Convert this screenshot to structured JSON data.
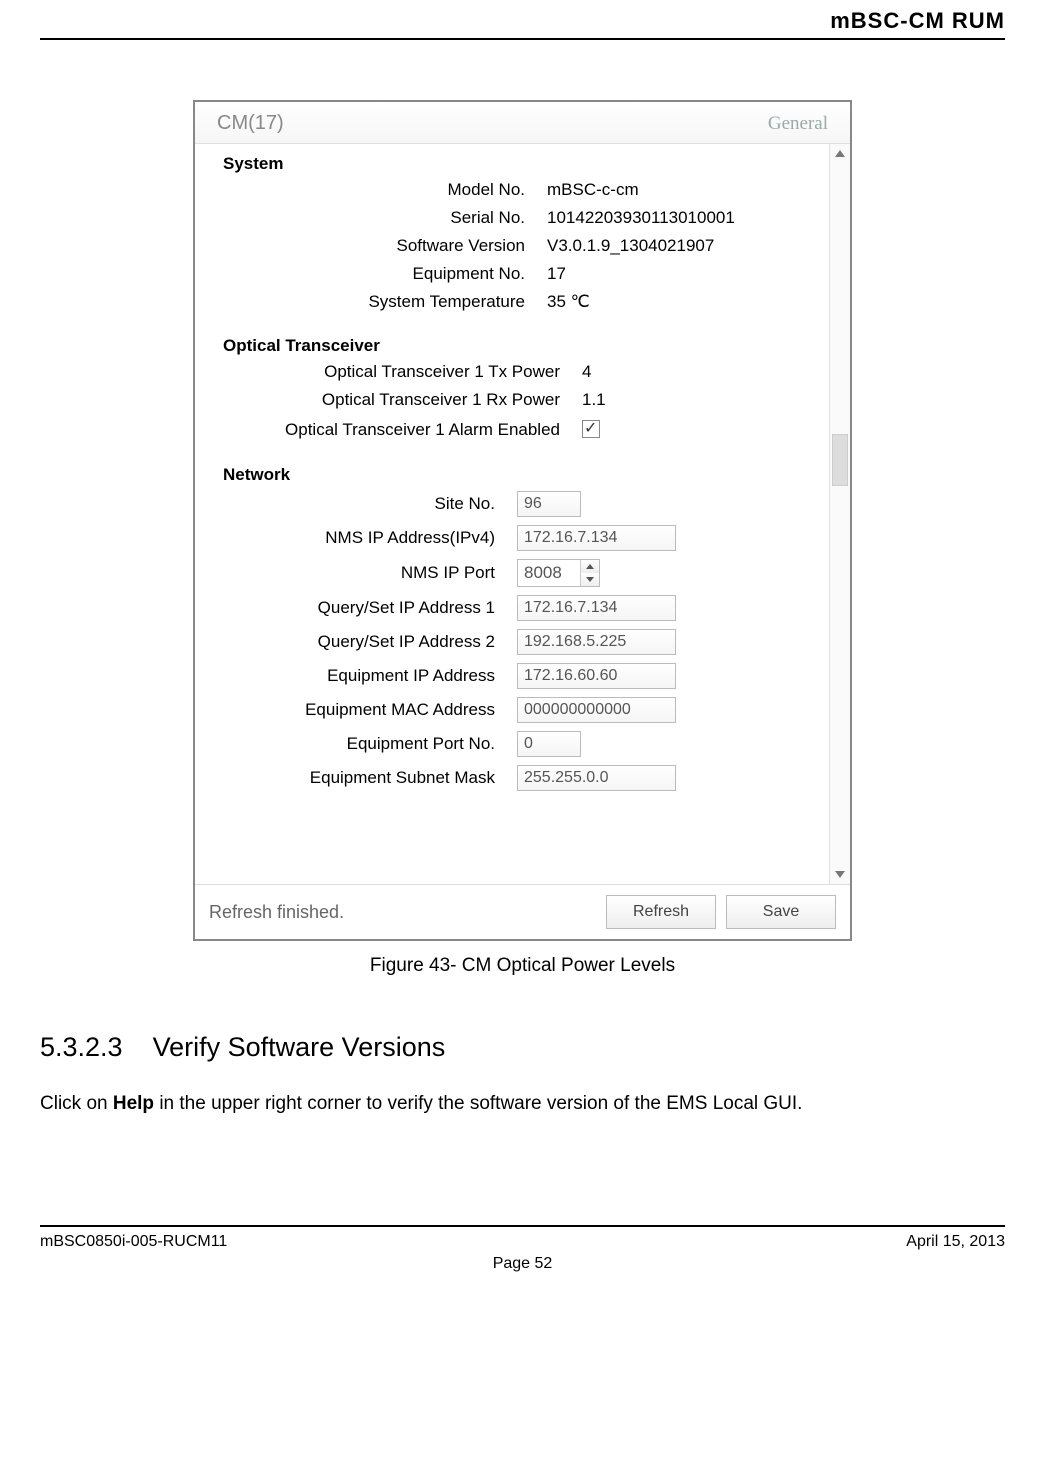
{
  "doc": {
    "header": "mBSC-CM   RUM",
    "figure_caption": "Figure 43- CM Optical Power Levels",
    "section_number": "5.3.2.3",
    "section_title": "Verify Software Versions",
    "body_prefix": "Click on ",
    "body_bold": "Help",
    "body_suffix": " in the upper right corner to verify the software version of the EMS Local GUI.",
    "footer_left": "mBSC0850i-005-RUCM11",
    "footer_right": "April 15, 2013",
    "footer_center": "Page 52"
  },
  "panel": {
    "title": "CM(17)",
    "tab": "General",
    "status": "Refresh finished.",
    "refresh": "Refresh",
    "save": "Save",
    "system": {
      "heading": "System",
      "model_label": "Model No.",
      "model": "mBSC-c-cm",
      "serial_label": "Serial No.",
      "serial": "10142203930113010001",
      "swver_label": "Software Version",
      "swver": "V3.0.1.9_1304021907",
      "eqno_label": "Equipment No.",
      "eqno": "17",
      "temp_label": "System Temperature",
      "temp": "35   ℃"
    },
    "optical": {
      "heading": "Optical Transceiver",
      "tx_label": "Optical Transceiver 1 Tx Power",
      "tx": "4",
      "rx_label": "Optical Transceiver 1 Rx Power",
      "rx": "1.1",
      "alarm_label": "Optical Transceiver 1 Alarm Enabled"
    },
    "network": {
      "heading": "Network",
      "site_label": "Site No.",
      "site": "96",
      "nmsip_label": "NMS IP Address(IPv4)",
      "nmsip": "172.16.7.134",
      "nmsport_label": "NMS IP Port",
      "nmsport": "8008",
      "q1_label": "Query/Set IP Address 1",
      "q1": "172.16.7.134",
      "q2_label": "Query/Set IP Address 2",
      "q2": "192.168.5.225",
      "eqip_label": "Equipment IP Address",
      "eqip": "172.16.60.60",
      "mac_label": "Equipment MAC Address",
      "mac": "000000000000",
      "eqport_label": "Equipment Port No.",
      "eqport": "0",
      "subnet_label": "Equipment Subnet Mask",
      "subnet": "255.255.0.0"
    }
  }
}
